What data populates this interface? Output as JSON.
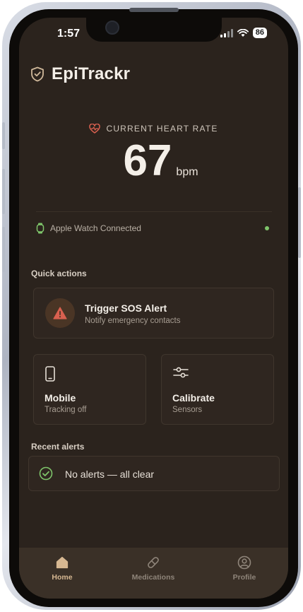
{
  "status_bar": {
    "time": "1:57",
    "battery": "86"
  },
  "app": {
    "name": "EpiTrackr"
  },
  "heart_rate": {
    "label": "CURRENT HEART RATE",
    "value": "67",
    "unit": "bpm"
  },
  "device": {
    "label": "Apple Watch Connected",
    "connected": true
  },
  "quick_actions": {
    "title": "Quick actions",
    "sos": {
      "title": "Trigger SOS Alert",
      "subtitle": "Notify emergency contacts"
    },
    "tiles": [
      {
        "title": "Mobile",
        "subtitle": "Tracking off",
        "icon": "phone-icon"
      },
      {
        "title": "Calibrate",
        "subtitle": "Sensors",
        "icon": "sliders-icon"
      }
    ]
  },
  "recent_alerts": {
    "title": "Recent alerts",
    "empty_text": "No alerts — all clear"
  },
  "tabs": [
    {
      "label": "Home",
      "icon": "home-icon",
      "active": true
    },
    {
      "label": "Medications",
      "icon": "pill-icon",
      "active": false
    },
    {
      "label": "Profile",
      "icon": "profile-icon",
      "active": false
    }
  ],
  "colors": {
    "background": "#2b231d",
    "card": "#2f2620",
    "accent": "#d7b892",
    "heart": "#d9604f",
    "success": "#7ec46a",
    "warning": "#d9604f"
  }
}
